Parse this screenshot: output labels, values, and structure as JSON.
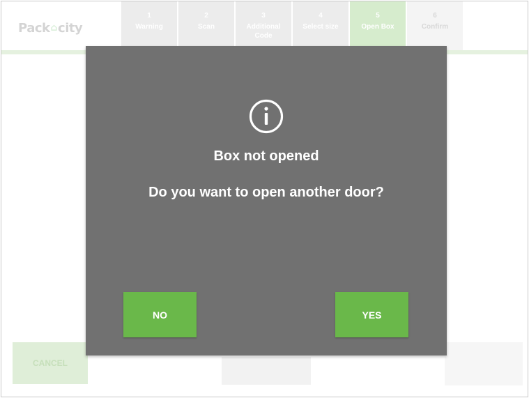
{
  "header": {
    "logo_left": "Pack",
    "logo_mid": "⌂",
    "logo_right": "city",
    "steps": [
      {
        "num": "1",
        "label": "Warning"
      },
      {
        "num": "2",
        "label": "Scan"
      },
      {
        "num": "3",
        "label": "Additional Code"
      },
      {
        "num": "4",
        "label": "Select size"
      },
      {
        "num": "5",
        "label": "Open Box"
      },
      {
        "num": "6",
        "label": "Confirm"
      }
    ]
  },
  "background": {
    "cancel_label": "CANCEL"
  },
  "dialog": {
    "icon": "info-icon",
    "title": "Box not opened",
    "question": "Do you want to open another door?",
    "no_label": "NO",
    "yes_label": "YES"
  },
  "colors": {
    "accent_green": "#6ab84a",
    "modal_gray": "#717171"
  }
}
